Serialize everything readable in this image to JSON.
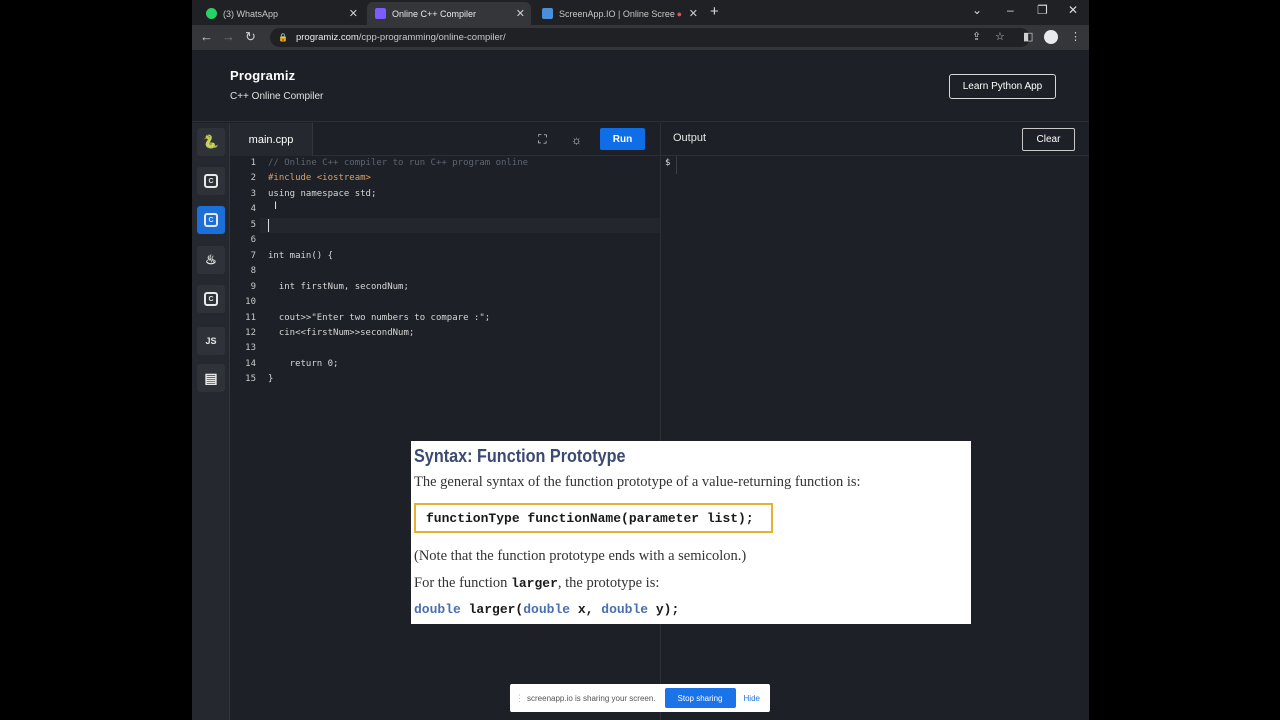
{
  "browser": {
    "tabs": [
      {
        "title": "(3) WhatsApp",
        "icon": "whatsapp-icon",
        "color": "#25d366",
        "active": false
      },
      {
        "title": "Online C++ Compiler",
        "icon": "programiz-icon",
        "color": "#7a5cff",
        "active": true
      },
      {
        "title": "ScreenApp.IO | Online Scree",
        "icon": "screenapp-icon",
        "color": "#4a90d9",
        "active": false
      }
    ],
    "new_tab": "+",
    "url_host": "programiz.com",
    "url_path": "/cpp-programming/online-compiler/",
    "window_controls": {
      "collapse": "⌄",
      "minimize": "–",
      "restore": "❐",
      "close": "✕"
    }
  },
  "site": {
    "logo": "Programiz",
    "subtitle": "C++ Online Compiler",
    "learn_button": "Learn Python App"
  },
  "sidebar": {
    "languages": [
      {
        "name": "python",
        "label": "🐍"
      },
      {
        "name": "c",
        "label": "C"
      },
      {
        "name": "cpp",
        "label": "C",
        "active": true
      },
      {
        "name": "java",
        "label": "♨"
      },
      {
        "name": "csharp",
        "label": "C"
      },
      {
        "name": "javascript",
        "label": "JS"
      },
      {
        "name": "sql",
        "label": "▤"
      }
    ]
  },
  "editor": {
    "file_tab": "main.cpp",
    "run_label": "Run",
    "lines": [
      {
        "n": "1",
        "code": "// Online C++ compiler to run C++ program online"
      },
      {
        "n": "2",
        "code": "#include <iostream>"
      },
      {
        "n": "3",
        "code": "using namespace std;"
      },
      {
        "n": "4",
        "code": ""
      },
      {
        "n": "5",
        "code": ""
      },
      {
        "n": "6",
        "code": ""
      },
      {
        "n": "7",
        "code": "int main() {"
      },
      {
        "n": "8",
        "code": ""
      },
      {
        "n": "9",
        "code": "  int firstNum, secondNum;"
      },
      {
        "n": "10",
        "code": ""
      },
      {
        "n": "11",
        "code": "  cout>>\"Enter two numbers to compare :\";"
      },
      {
        "n": "12",
        "code": "  cin<<firstNum>>secondNum;"
      },
      {
        "n": "13",
        "code": ""
      },
      {
        "n": "14",
        "code": "    return 0;"
      },
      {
        "n": "15",
        "code": "}"
      }
    ]
  },
  "output": {
    "title": "Output",
    "clear_label": "Clear",
    "prompt": "$"
  },
  "slide": {
    "heading": "Syntax: Function Prototype",
    "intro": "The general syntax of the function prototype of a value-returning function is:",
    "syntax": "functionType functionName(parameter list);",
    "note": "(Note that the function prototype ends with a semicolon.)",
    "for_prefix": "For the function ",
    "for_name": "larger",
    "for_suffix": ", the prototype is:",
    "example": {
      "kw1": "double",
      "name": " larger(",
      "kw2": "double",
      "p1": " x, ",
      "kw3": "double",
      "p2": " y);"
    }
  },
  "sharebar": {
    "message": "screenapp.io is sharing your screen.",
    "stop_label": "Stop sharing",
    "hide_label": "Hide"
  }
}
